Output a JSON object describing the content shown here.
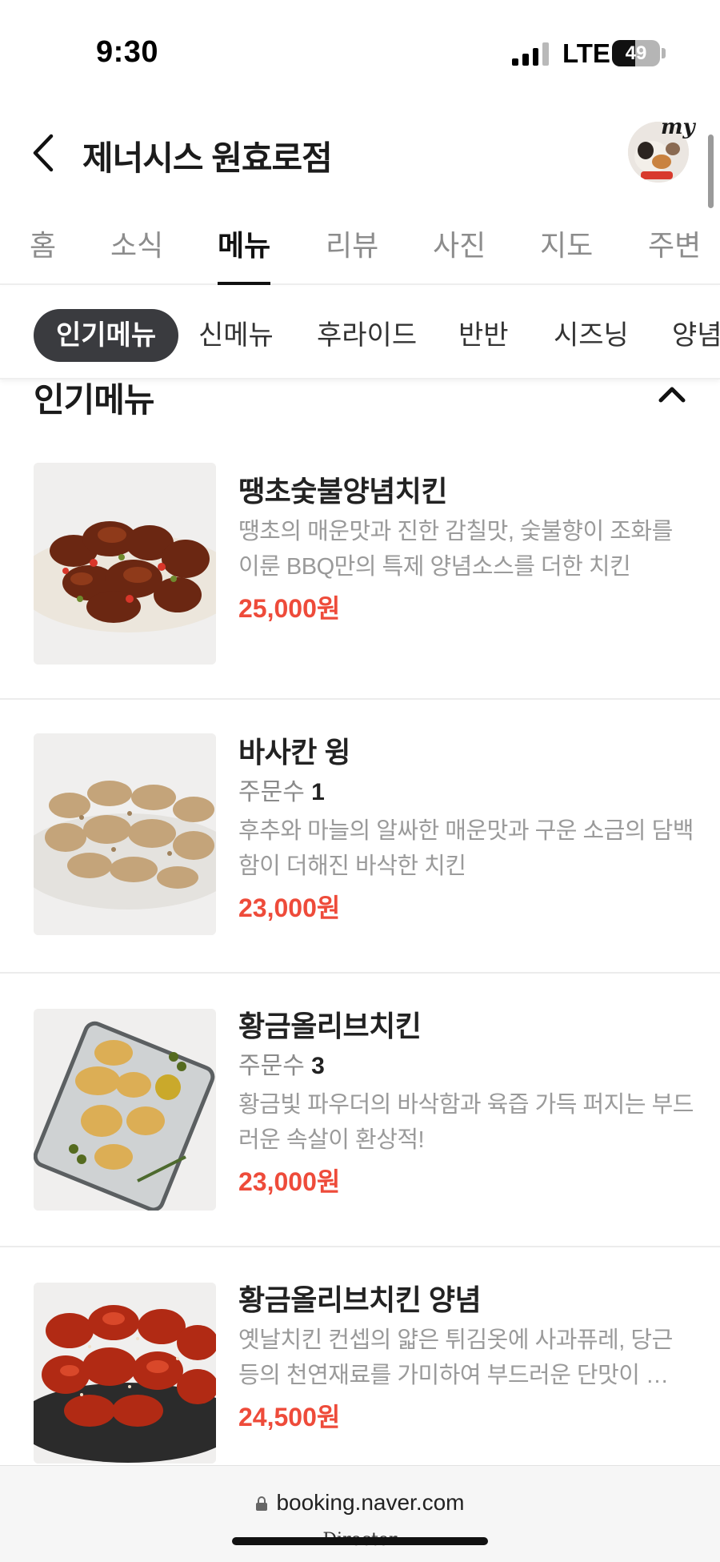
{
  "status": {
    "time": "9:30",
    "carrier": "LTE",
    "battery": "49",
    "battery_level": 0.49
  },
  "header": {
    "title": "제너시스 원효로점",
    "avatar_badge": "my"
  },
  "tabs": [
    {
      "label": "홈"
    },
    {
      "label": "소식"
    },
    {
      "label": "메뉴",
      "active": true
    },
    {
      "label": "리뷰"
    },
    {
      "label": "사진"
    },
    {
      "label": "지도"
    },
    {
      "label": "주변"
    }
  ],
  "categories": [
    {
      "label": "인기메뉴",
      "active": true
    },
    {
      "label": "신메뉴"
    },
    {
      "label": "후라이드"
    },
    {
      "label": "반반"
    },
    {
      "label": "시즈닝"
    },
    {
      "label": "양념"
    }
  ],
  "section": {
    "title": "인기메뉴"
  },
  "menu_items": [
    {
      "name": "땡초숯불양념치킨",
      "orders_label": "",
      "orders_count": "",
      "description": "땡초의 매운맛과 진한 감칠맛, 숯불향이 조화를 이룬 BBQ만의 특제 양념소스를 더한 치킨",
      "price": "25,000원"
    },
    {
      "name": "바사칸 윙",
      "orders_label": "주문수",
      "orders_count": "1",
      "description": "후추와 마늘의 알싸한 매운맛과 구운 소금의 담백함이 더해진 바삭한 치킨",
      "price": "23,000원"
    },
    {
      "name": "황금올리브치킨",
      "orders_label": "주문수",
      "orders_count": "3",
      "description": "황금빛 파우더의 바삭함과 육즙 가득 퍼지는 부드러운 속살이 환상적!",
      "price": "23,000원"
    },
    {
      "name": "황금올리브치킨 양념",
      "orders_label": "",
      "orders_count": "",
      "description": "옛날치킨 컨셉의 얇은 튀김옷에 사과퓨레, 당근 등의 천연재료를 가미하여 부드러운 단맛이 …",
      "price": "24,500원"
    }
  ],
  "url_bar": {
    "url": "booking.naver.com",
    "overlay_text": "Director"
  },
  "colors": {
    "price": "#ee4b3a",
    "chip_active_bg": "#3a3b3f"
  }
}
